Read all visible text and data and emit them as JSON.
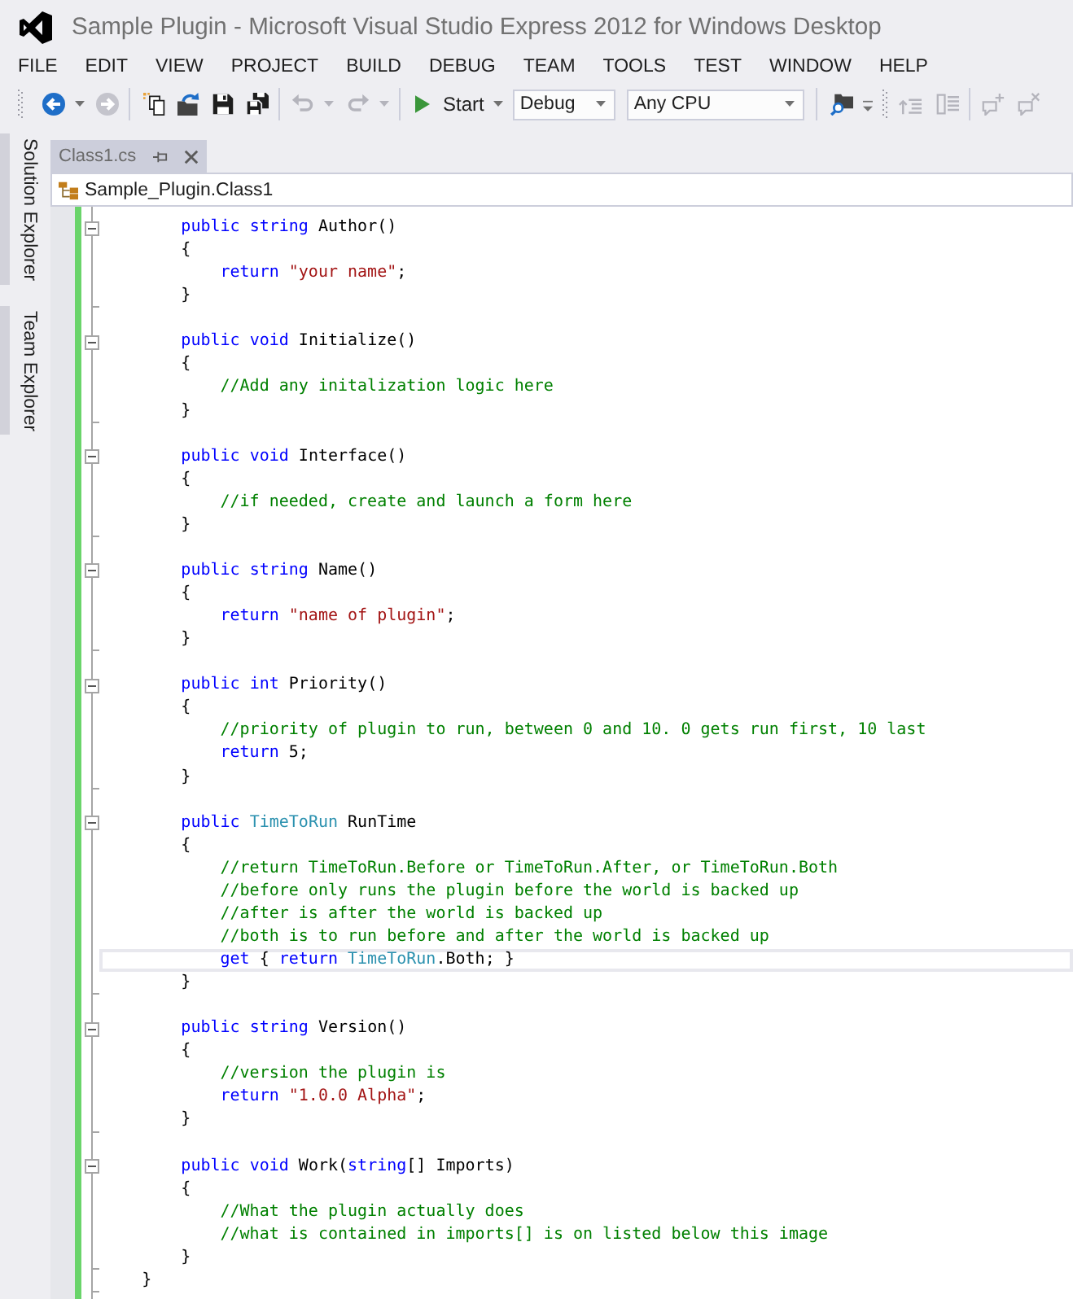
{
  "window": {
    "title": "Sample Plugin - Microsoft Visual Studio Express 2012 for Windows Desktop"
  },
  "menu": [
    "FILE",
    "EDIT",
    "VIEW",
    "PROJECT",
    "BUILD",
    "DEBUG",
    "TEAM",
    "TOOLS",
    "TEST",
    "WINDOW",
    "HELP"
  ],
  "toolbar": {
    "navigation": [
      {
        "disabled": false
      },
      {
        "disabled": true
      }
    ],
    "edit_buttons": [
      {
        "disabled": true
      },
      {
        "disabled": true
      }
    ],
    "start_button": {
      "label": "Start"
    },
    "configuration": {
      "value": "Debug"
    },
    "platform": {
      "value": "Any CPU"
    },
    "format_buttons": [
      {
        "disabled": true
      },
      {
        "disabled": true
      }
    ],
    "comment_buttons": [
      {
        "disabled": true
      },
      {
        "disabled": true
      }
    ]
  },
  "side_tabs": [
    {
      "label": "Solution Explorer"
    },
    {
      "label": "Team Explorer"
    }
  ],
  "document_tabs": [
    {
      "label": "Class1.cs",
      "selected": true
    }
  ],
  "navigation_bar": {
    "type": "Sample_Plugin.Class1"
  },
  "editor": {
    "lines": [
      {
        "kind": "code",
        "current": false,
        "fold": {
          "expanded": true
        },
        "segments": [
          {
            "kind": "keyword",
            "text": "        public string"
          },
          {
            "kind": "plain",
            "text": " Author()"
          }
        ]
      },
      {
        "kind": "code",
        "current": false,
        "segments": [
          {
            "kind": "plain",
            "text": "        {"
          }
        ]
      },
      {
        "kind": "code",
        "current": false,
        "segments": [
          {
            "kind": "keyword",
            "text": "            return"
          },
          {
            "kind": "string",
            "text": " \"your name\""
          },
          {
            "kind": "plain",
            "text": ";"
          }
        ]
      },
      {
        "kind": "code",
        "current": false,
        "block_end": true,
        "segments": [
          {
            "kind": "plain",
            "text": "        }"
          }
        ]
      },
      {
        "kind": "blank",
        "current": false
      },
      {
        "kind": "code",
        "current": false,
        "fold": {
          "expanded": true
        },
        "segments": [
          {
            "kind": "keyword",
            "text": "        public void"
          },
          {
            "kind": "plain",
            "text": " Initialize()"
          }
        ]
      },
      {
        "kind": "code",
        "current": false,
        "segments": [
          {
            "kind": "plain",
            "text": "        {"
          }
        ]
      },
      {
        "kind": "code",
        "current": false,
        "segments": [
          {
            "kind": "comment",
            "text": "            //Add any initalization logic here"
          }
        ]
      },
      {
        "kind": "code",
        "current": false,
        "block_end": true,
        "segments": [
          {
            "kind": "plain",
            "text": "        }"
          }
        ]
      },
      {
        "kind": "blank",
        "current": false
      },
      {
        "kind": "code",
        "current": false,
        "fold": {
          "expanded": true
        },
        "segments": [
          {
            "kind": "keyword",
            "text": "        public void"
          },
          {
            "kind": "plain",
            "text": " Interface()"
          }
        ]
      },
      {
        "kind": "code",
        "current": false,
        "segments": [
          {
            "kind": "plain",
            "text": "        {"
          }
        ]
      },
      {
        "kind": "code",
        "current": false,
        "segments": [
          {
            "kind": "comment",
            "text": "            //if needed, create and launch a form here"
          }
        ]
      },
      {
        "kind": "code",
        "current": false,
        "block_end": true,
        "segments": [
          {
            "kind": "plain",
            "text": "        }"
          }
        ]
      },
      {
        "kind": "blank",
        "current": false
      },
      {
        "kind": "code",
        "current": false,
        "fold": {
          "expanded": true
        },
        "segments": [
          {
            "kind": "keyword",
            "text": "        public string"
          },
          {
            "kind": "plain",
            "text": " Name()"
          }
        ]
      },
      {
        "kind": "code",
        "current": false,
        "segments": [
          {
            "kind": "plain",
            "text": "        {"
          }
        ]
      },
      {
        "kind": "code",
        "current": false,
        "segments": [
          {
            "kind": "keyword",
            "text": "            return"
          },
          {
            "kind": "string",
            "text": " \"name of plugin\""
          },
          {
            "kind": "plain",
            "text": ";"
          }
        ]
      },
      {
        "kind": "code",
        "current": false,
        "block_end": true,
        "segments": [
          {
            "kind": "plain",
            "text": "        }"
          }
        ]
      },
      {
        "kind": "blank",
        "current": false
      },
      {
        "kind": "code",
        "current": false,
        "fold": {
          "expanded": true
        },
        "segments": [
          {
            "kind": "keyword",
            "text": "        public int"
          },
          {
            "kind": "plain",
            "text": " Priority()"
          }
        ]
      },
      {
        "kind": "code",
        "current": false,
        "segments": [
          {
            "kind": "plain",
            "text": "        {"
          }
        ]
      },
      {
        "kind": "code",
        "current": false,
        "segments": [
          {
            "kind": "comment",
            "text": "            //priority of plugin to run, between 0 and 10. 0 gets run first, 10 last"
          }
        ]
      },
      {
        "kind": "code",
        "current": false,
        "segments": [
          {
            "kind": "keyword",
            "text": "            return"
          },
          {
            "kind": "plain",
            "text": " 5;"
          }
        ]
      },
      {
        "kind": "code",
        "current": false,
        "block_end": true,
        "segments": [
          {
            "kind": "plain",
            "text": "        }"
          }
        ]
      },
      {
        "kind": "blank",
        "current": false
      },
      {
        "kind": "code",
        "current": false,
        "fold": {
          "expanded": true
        },
        "segments": [
          {
            "kind": "keyword",
            "text": "        public"
          },
          {
            "kind": "type",
            "text": " TimeToRun"
          },
          {
            "kind": "plain",
            "text": " RunTime"
          }
        ]
      },
      {
        "kind": "code",
        "current": false,
        "segments": [
          {
            "kind": "plain",
            "text": "        {"
          }
        ]
      },
      {
        "kind": "code",
        "current": false,
        "segments": [
          {
            "kind": "comment",
            "text": "            //return TimeToRun.Before or TimeToRun.After, or TimeToRun.Both"
          }
        ]
      },
      {
        "kind": "code",
        "current": false,
        "segments": [
          {
            "kind": "comment",
            "text": "            //before only runs the plugin before the world is backed up"
          }
        ]
      },
      {
        "kind": "code",
        "current": false,
        "segments": [
          {
            "kind": "comment",
            "text": "            //after is after the world is backed up"
          }
        ]
      },
      {
        "kind": "code",
        "current": false,
        "segments": [
          {
            "kind": "comment",
            "text": "            //both is to run before and after the world is backed up"
          }
        ]
      },
      {
        "kind": "code",
        "current": true,
        "segments": [
          {
            "kind": "keyword",
            "text": "            get"
          },
          {
            "kind": "plain",
            "text": " { "
          },
          {
            "kind": "keyword",
            "text": "return"
          },
          {
            "kind": "type",
            "text": " TimeToRun"
          },
          {
            "kind": "plain",
            "text": ".Both; }"
          }
        ]
      },
      {
        "kind": "code",
        "current": false,
        "block_end": true,
        "segments": [
          {
            "kind": "plain",
            "text": "        }"
          }
        ]
      },
      {
        "kind": "blank",
        "current": false
      },
      {
        "kind": "code",
        "current": false,
        "fold": {
          "expanded": true
        },
        "segments": [
          {
            "kind": "keyword",
            "text": "        public string"
          },
          {
            "kind": "plain",
            "text": " Version()"
          }
        ]
      },
      {
        "kind": "code",
        "current": false,
        "segments": [
          {
            "kind": "plain",
            "text": "        {"
          }
        ]
      },
      {
        "kind": "code",
        "current": false,
        "segments": [
          {
            "kind": "comment",
            "text": "            //version the plugin is"
          }
        ]
      },
      {
        "kind": "code",
        "current": false,
        "segments": [
          {
            "kind": "keyword",
            "text": "            return"
          },
          {
            "kind": "string",
            "text": " \"1.0.0 Alpha\""
          },
          {
            "kind": "plain",
            "text": ";"
          }
        ]
      },
      {
        "kind": "code",
        "current": false,
        "block_end": true,
        "segments": [
          {
            "kind": "plain",
            "text": "        }"
          }
        ]
      },
      {
        "kind": "blank",
        "current": false
      },
      {
        "kind": "code",
        "current": false,
        "fold": {
          "expanded": true
        },
        "segments": [
          {
            "kind": "keyword",
            "text": "        public void"
          },
          {
            "kind": "plain",
            "text": " Work("
          },
          {
            "kind": "keyword",
            "text": "string"
          },
          {
            "kind": "plain",
            "text": "[] Imports)"
          }
        ]
      },
      {
        "kind": "code",
        "current": false,
        "segments": [
          {
            "kind": "plain",
            "text": "        {"
          }
        ]
      },
      {
        "kind": "code",
        "current": false,
        "segments": [
          {
            "kind": "comment",
            "text": "            //What the plugin actually does"
          }
        ]
      },
      {
        "kind": "code",
        "current": false,
        "segments": [
          {
            "kind": "comment",
            "text": "            //what is contained in imports[] is on listed below this image"
          }
        ]
      },
      {
        "kind": "code",
        "current": false,
        "block_end": true,
        "segments": [
          {
            "kind": "plain",
            "text": "        }"
          }
        ]
      },
      {
        "kind": "code",
        "current": false,
        "block_end": true,
        "segments": [
          {
            "kind": "plain",
            "text": "    }"
          }
        ]
      }
    ]
  }
}
